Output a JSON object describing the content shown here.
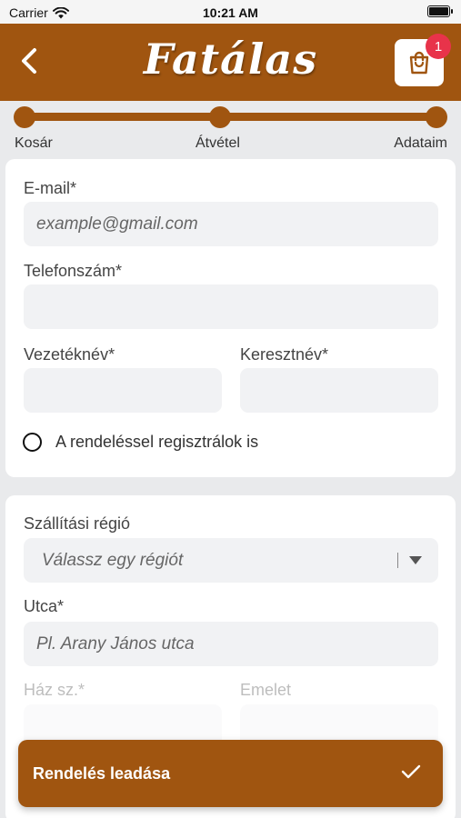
{
  "status_bar": {
    "carrier": "Carrier",
    "time": "10:21 AM"
  },
  "header": {
    "logo_text": "Fatálas",
    "cart_count": "1",
    "brand_color": "#a05510"
  },
  "progress": {
    "steps": [
      "Kosár",
      "Átvétel",
      "Adataim"
    ]
  },
  "contact": {
    "email_label": "E-mail*",
    "email_placeholder": "example@gmail.com",
    "phone_label": "Telefonszám*",
    "phone_placeholder": "",
    "lastname_label": "Vezetéknév*",
    "firstname_label": "Keresztnév*",
    "register_label": "A rendeléssel regisztrálok is"
  },
  "shipping": {
    "region_label": "Szállítási régió",
    "region_placeholder": "Válassz egy régiót",
    "street_label": "Utca*",
    "street_placeholder": "Pl. Arany János utca",
    "house_label": "Ház sz.*",
    "floor_label": "Emelet"
  },
  "submit": {
    "label": "Rendelés leadása"
  }
}
